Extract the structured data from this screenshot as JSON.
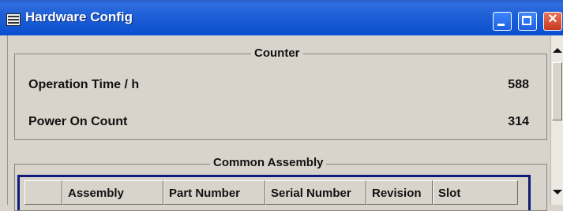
{
  "window": {
    "title": "Hardware Config",
    "icon": "hardware-config-app-icon"
  },
  "counter": {
    "title": "Counter",
    "rows": [
      {
        "label": "Operation Time / h",
        "value": "588"
      },
      {
        "label": "Power On Count",
        "value": "314"
      }
    ]
  },
  "assembly": {
    "title": "Common Assembly",
    "columns": [
      "",
      "Assembly",
      "Part Number",
      "Serial Number",
      "Revision",
      "Slot"
    ]
  },
  "colors": {
    "titlebar": "#0a4fd0",
    "table_border": "#101a7a",
    "background": "#d8d4cc"
  }
}
